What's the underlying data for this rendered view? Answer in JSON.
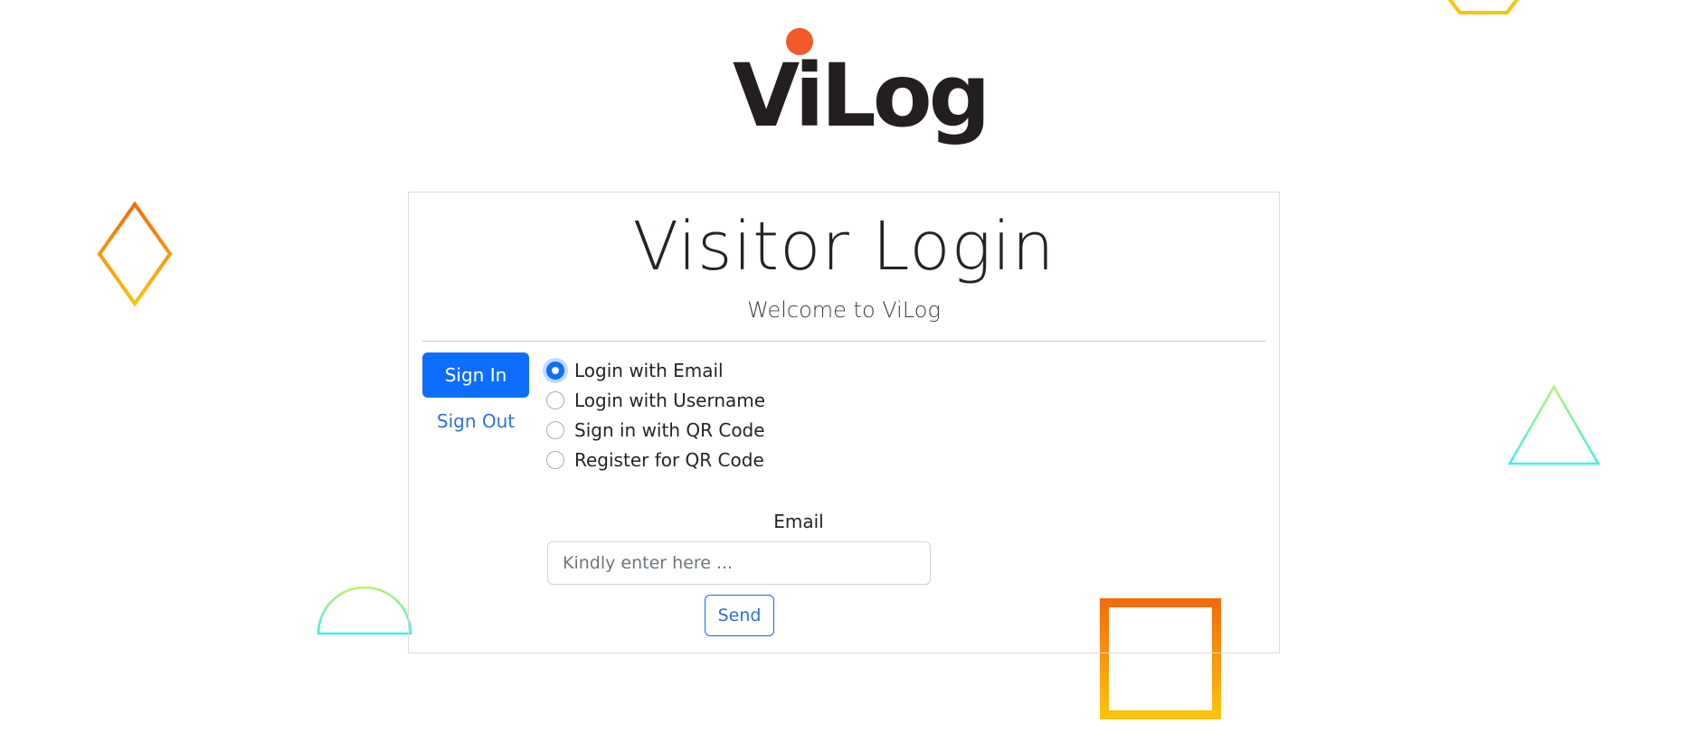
{
  "logo": {
    "text": "ViLog",
    "dot_color": "#f05a28",
    "text_color": "#231f20"
  },
  "card": {
    "title": "Visitor Login",
    "subtitle": "Welcome to ViLog"
  },
  "actions": {
    "sign_in_label": "Sign In",
    "sign_out_label": "Sign Out"
  },
  "login_options": [
    {
      "label": "Login with Email",
      "checked": true
    },
    {
      "label": "Login with Username",
      "checked": false
    },
    {
      "label": "Sign in with QR Code",
      "checked": false
    },
    {
      "label": "Register for QR Code",
      "checked": false
    }
  ],
  "form": {
    "email_label": "Email",
    "email_placeholder": "Kindly enter here ...",
    "email_value": "",
    "send_label": "Send"
  },
  "colors": {
    "primary": "#0d6efd",
    "link": "#2f6fd6",
    "orange": "#f46b0b",
    "yellow": "#fbc30c",
    "green": "#b6f36a",
    "cyan": "#3ff0e6"
  },
  "decorations": [
    "diamond-shape",
    "semicircle-shape",
    "square-outline-shape",
    "triangle-outline-shape",
    "hexagon-outline-shape"
  ]
}
